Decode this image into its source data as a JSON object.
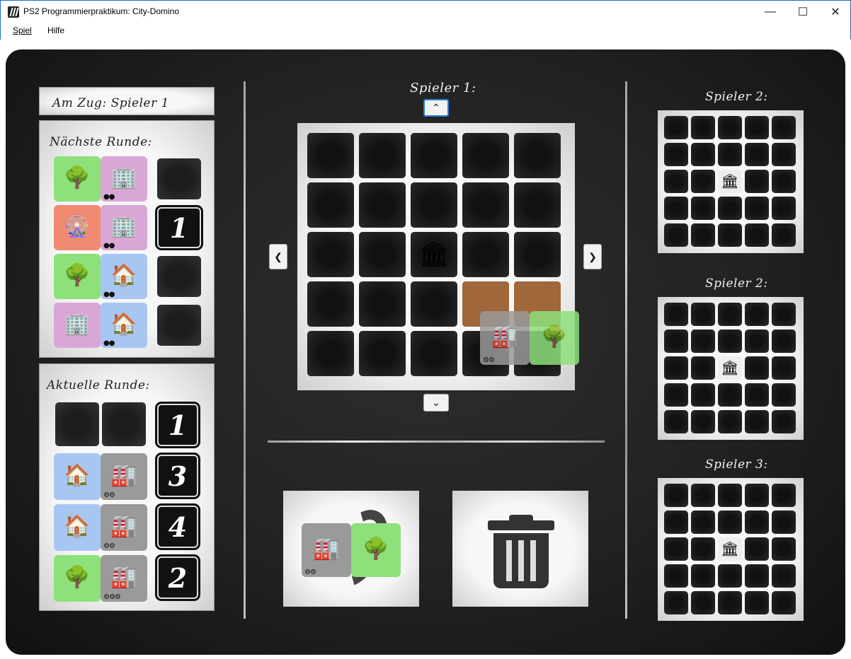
{
  "window": {
    "title": "PS2 Programmierpraktikum: City-Domino"
  },
  "menu": {
    "items": [
      "Spiel",
      "Hilfe"
    ]
  },
  "turn": {
    "label": "Am Zug: Spieler 1"
  },
  "next_round": {
    "label": "Nächste Runde:",
    "rows": [
      {
        "left": {
          "type": "park",
          "icon": "park-icon",
          "crowns": ""
        },
        "right": {
          "type": "office",
          "icon": "office-icon",
          "crowns": "●●"
        },
        "number": ""
      },
      {
        "left": {
          "type": "fun",
          "icon": "amusement-icon",
          "crowns": ""
        },
        "right": {
          "type": "office",
          "icon": "office-icon",
          "crowns": "●●"
        },
        "number": "1"
      },
      {
        "left": {
          "type": "park",
          "icon": "park-icon",
          "crowns": ""
        },
        "right": {
          "type": "house",
          "icon": "house-icon",
          "crowns": "●●"
        },
        "number": ""
      },
      {
        "left": {
          "type": "office",
          "icon": "office-icon",
          "crowns": ""
        },
        "right": {
          "type": "house",
          "icon": "house-icon",
          "crowns": "●●"
        },
        "number": ""
      }
    ]
  },
  "current_round": {
    "label": "Aktuelle Runde:",
    "rows": [
      {
        "empty": true,
        "number": "1"
      },
      {
        "left": {
          "type": "house",
          "icon": "house-icon",
          "crowns": ""
        },
        "right": {
          "type": "industry",
          "icon": "factory-icon",
          "crowns": "⚙⚙"
        },
        "number": "3"
      },
      {
        "left": {
          "type": "house",
          "icon": "house-icon",
          "crowns": ""
        },
        "right": {
          "type": "industry",
          "icon": "factory-icon",
          "crowns": "⚙⚙"
        },
        "number": "4"
      },
      {
        "left": {
          "type": "park",
          "icon": "park-icon",
          "crowns": ""
        },
        "right": {
          "type": "industry",
          "icon": "factory-icon",
          "crowns": "⚙⚙⚙"
        },
        "number": "2"
      }
    ]
  },
  "main_board": {
    "player_label": "Spieler 1:",
    "castle": {
      "row": 2,
      "col": 2,
      "icon": "castle-icon"
    },
    "placed": [
      {
        "row": 3,
        "col": 3,
        "type": "dirt"
      },
      {
        "row": 3,
        "col": 4,
        "type": "dirt"
      }
    ],
    "preview": {
      "left": {
        "type": "industry",
        "icon": "factory-icon",
        "crowns": "⚙⚙"
      },
      "right": {
        "type": "park",
        "icon": "park-icon",
        "crowns": ""
      }
    }
  },
  "rotate_panel": {
    "left": {
      "type": "industry",
      "icon": "factory-icon",
      "crowns": "⚙⚙"
    },
    "right": {
      "type": "park",
      "icon": "park-icon",
      "crowns": ""
    }
  },
  "side_boards": [
    {
      "label": "Spieler 2:",
      "castle": {
        "row": 2,
        "col": 2
      }
    },
    {
      "label": "Spieler 2:",
      "castle": {
        "row": 2,
        "col": 2
      }
    },
    {
      "label": "Spieler 3:",
      "castle": {
        "row": 2,
        "col": 2
      }
    }
  ],
  "icons": {
    "trash": "trash-icon",
    "rotate": "rotate-icon",
    "up": "chevron-up-icon",
    "down": "chevron-down-icon",
    "left": "chevron-left-icon",
    "right": "chevron-right-icon"
  }
}
